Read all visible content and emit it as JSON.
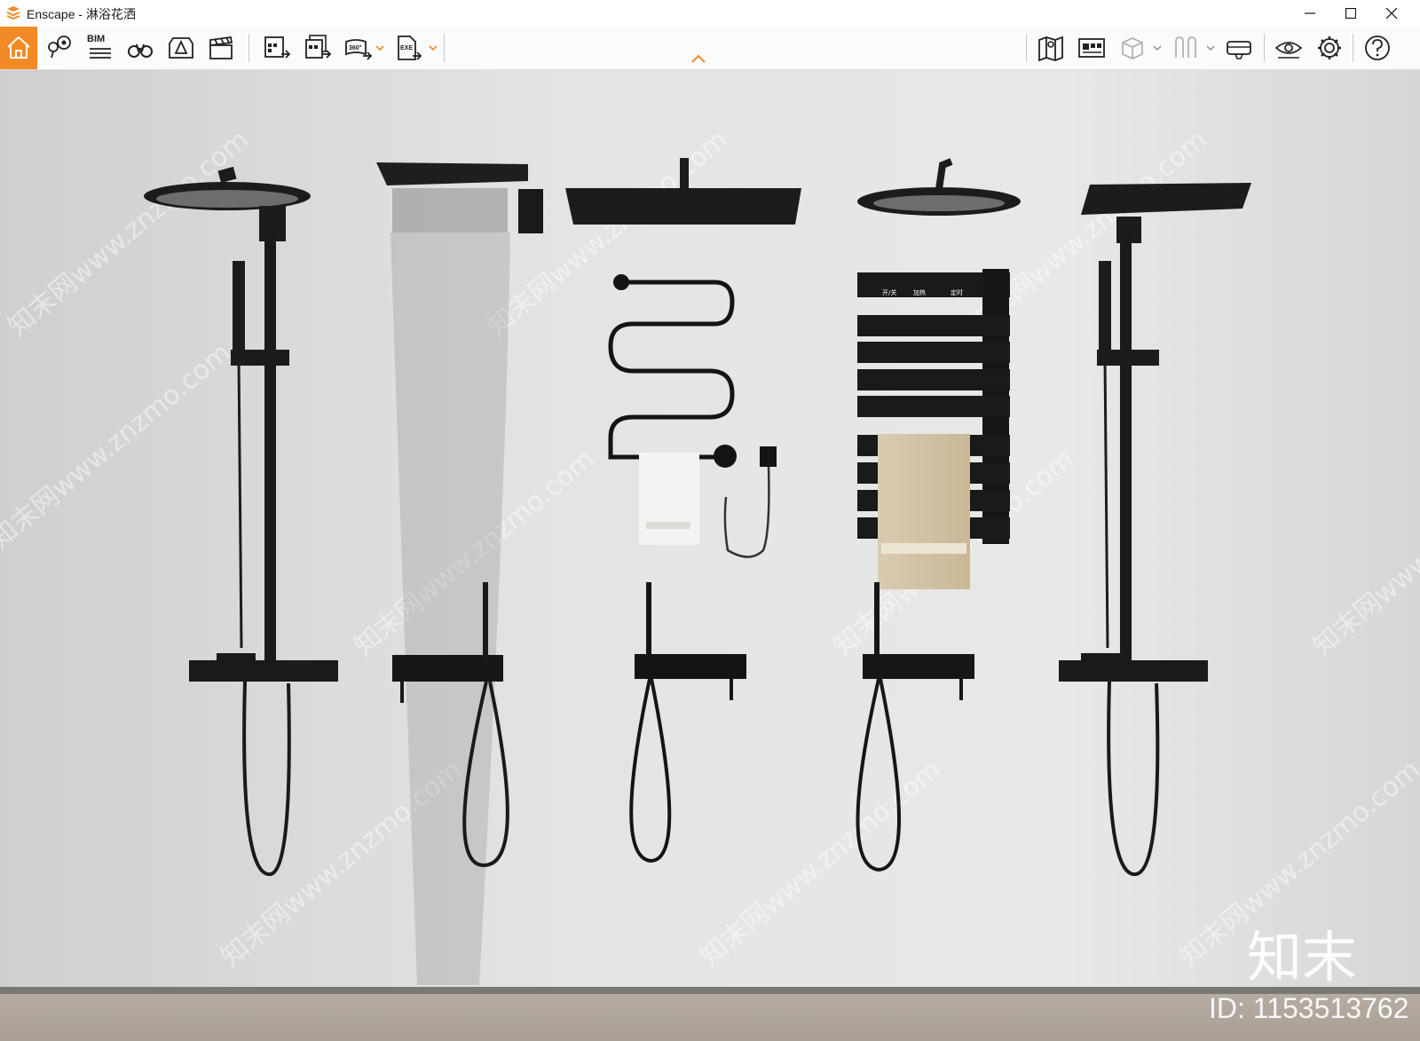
{
  "window": {
    "app_name": "Enscape",
    "separator": " - ",
    "document": "淋浴花洒",
    "accent_color": "#f28a25"
  },
  "toolbar": {
    "bim_label": "BIM",
    "render_360_label": "360°",
    "exe_label": "EXE",
    "left_icons": [
      "home-icon",
      "location-pin-icon",
      "bim-icon",
      "binoculars-icon",
      "asset-library-icon",
      "clapperboard-icon",
      "render-image-icon",
      "batch-render-icon",
      "render-panorama-icon",
      "export-exe-icon"
    ],
    "right_icons": [
      "map-icon",
      "screenshot-gallery-icon",
      "view-cube-icon",
      "walk-icon",
      "vr-headset-icon",
      "visual-settings-icon",
      "settings-gear-icon",
      "help-icon"
    ]
  },
  "viewport": {
    "watermark_text": "知末网www.znzmo.com",
    "brand_logo_text": "知末",
    "id_label": "ID: 1153513762",
    "panel_labels": [
      "开/关",
      "加热",
      "定时"
    ]
  }
}
